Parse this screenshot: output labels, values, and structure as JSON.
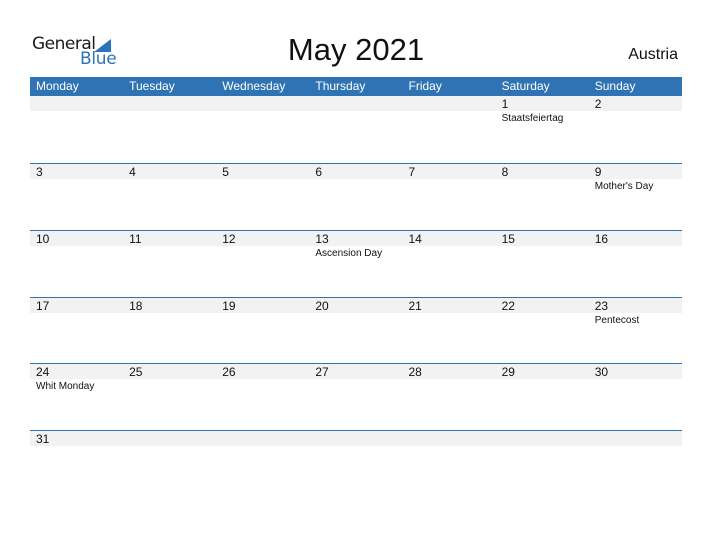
{
  "logo": {
    "word1": "General",
    "word2": "Blue",
    "icon": "flag-triangle-icon"
  },
  "title": "May 2021",
  "country": "Austria",
  "colors": {
    "accent": "#2f73b4",
    "band": "#f2f2f2"
  },
  "weekdays": [
    "Monday",
    "Tuesday",
    "Wednesday",
    "Thursday",
    "Friday",
    "Saturday",
    "Sunday"
  ],
  "weeks": [
    {
      "days": [
        {
          "num": "",
          "holiday": ""
        },
        {
          "num": "",
          "holiday": ""
        },
        {
          "num": "",
          "holiday": ""
        },
        {
          "num": "",
          "holiday": ""
        },
        {
          "num": "",
          "holiday": ""
        },
        {
          "num": "1",
          "holiday": "Staatsfeiertag"
        },
        {
          "num": "2",
          "holiday": ""
        }
      ]
    },
    {
      "days": [
        {
          "num": "3",
          "holiday": ""
        },
        {
          "num": "4",
          "holiday": ""
        },
        {
          "num": "5",
          "holiday": ""
        },
        {
          "num": "6",
          "holiday": ""
        },
        {
          "num": "7",
          "holiday": ""
        },
        {
          "num": "8",
          "holiday": ""
        },
        {
          "num": "9",
          "holiday": "Mother's Day"
        }
      ]
    },
    {
      "days": [
        {
          "num": "10",
          "holiday": ""
        },
        {
          "num": "11",
          "holiday": ""
        },
        {
          "num": "12",
          "holiday": ""
        },
        {
          "num": "13",
          "holiday": "Ascension Day"
        },
        {
          "num": "14",
          "holiday": ""
        },
        {
          "num": "15",
          "holiday": ""
        },
        {
          "num": "16",
          "holiday": ""
        }
      ]
    },
    {
      "days": [
        {
          "num": "17",
          "holiday": ""
        },
        {
          "num": "18",
          "holiday": ""
        },
        {
          "num": "19",
          "holiday": ""
        },
        {
          "num": "20",
          "holiday": ""
        },
        {
          "num": "21",
          "holiday": ""
        },
        {
          "num": "22",
          "holiday": ""
        },
        {
          "num": "23",
          "holiday": "Pentecost"
        }
      ]
    },
    {
      "days": [
        {
          "num": "24",
          "holiday": "Whit Monday"
        },
        {
          "num": "25",
          "holiday": ""
        },
        {
          "num": "26",
          "holiday": ""
        },
        {
          "num": "27",
          "holiday": ""
        },
        {
          "num": "28",
          "holiday": ""
        },
        {
          "num": "29",
          "holiday": ""
        },
        {
          "num": "30",
          "holiday": ""
        }
      ]
    },
    {
      "days": [
        {
          "num": "31",
          "holiday": ""
        },
        {
          "num": "",
          "holiday": ""
        },
        {
          "num": "",
          "holiday": ""
        },
        {
          "num": "",
          "holiday": ""
        },
        {
          "num": "",
          "holiday": ""
        },
        {
          "num": "",
          "holiday": ""
        },
        {
          "num": "",
          "holiday": ""
        }
      ]
    }
  ]
}
